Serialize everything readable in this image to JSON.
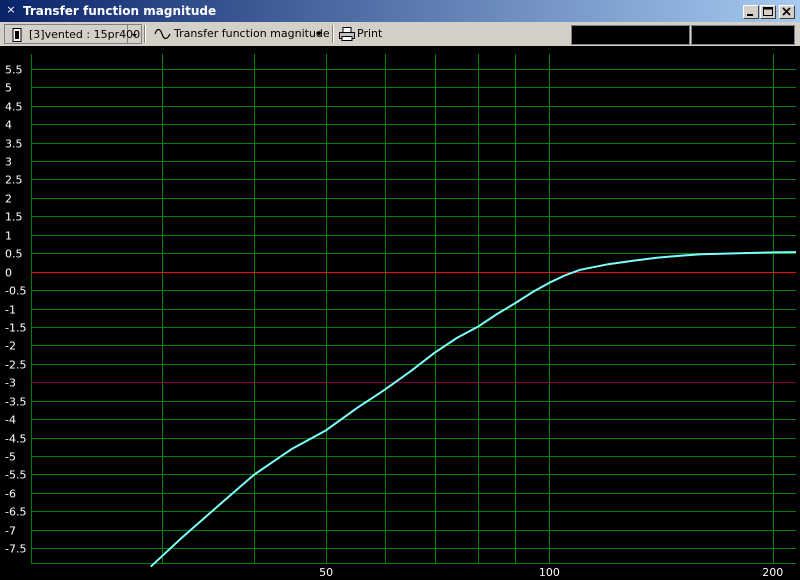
{
  "window": {
    "title": "Transfer function magnitude"
  },
  "toolbar": {
    "source_select_value": "[3]vented : 15pr400",
    "view_select_value": "Transfer function magnitude",
    "print_label": "Print",
    "readout_1": "",
    "readout_2": ""
  },
  "colors": {
    "plot_background": "#000000",
    "grid": "#008000",
    "zero_line": "#ff0000",
    "reference_line": "#800040",
    "curve": "#80ffff",
    "tick_labels": "#ffffff"
  },
  "chart_data": {
    "type": "line",
    "title": "",
    "xlabel": "",
    "ylabel": "",
    "x_scale": "log",
    "xlim": [
      20,
      215
    ],
    "ylim": [
      -7.9,
      5.9
    ],
    "x_ticks": [
      50,
      100,
      200
    ],
    "x_gridlines": [
      20,
      30,
      40,
      50,
      60,
      70,
      80,
      90,
      100,
      200
    ],
    "y_ticks": [
      5.5,
      5,
      4.5,
      4,
      3.5,
      3,
      2.5,
      2,
      1.5,
      1,
      0.5,
      0,
      -0.5,
      -1,
      -1.5,
      -2,
      -2.5,
      -3,
      -3.5,
      -4,
      -4.5,
      -5,
      -5.5,
      -6,
      -6.5,
      -7,
      -7.5
    ],
    "reference_lines": [
      {
        "y": 0,
        "color": "#ff0000"
      },
      {
        "y": -3,
        "color": "#800040"
      }
    ],
    "grid": true,
    "series": [
      {
        "color": "#80ffff",
        "x": [
          29,
          32,
          36,
          40,
          45,
          50,
          55,
          60,
          65,
          70,
          75,
          80,
          85,
          90,
          95,
          100,
          105,
          110,
          120,
          130,
          140,
          150,
          160,
          180,
          200,
          215
        ],
        "y": [
          -8.0,
          -7.2,
          -6.3,
          -5.5,
          -4.8,
          -4.3,
          -3.7,
          -3.2,
          -2.7,
          -2.2,
          -1.8,
          -1.5,
          -1.15,
          -0.85,
          -0.55,
          -0.3,
          -0.1,
          0.05,
          0.2,
          0.3,
          0.38,
          0.43,
          0.47,
          0.5,
          0.52,
          0.53
        ]
      }
    ]
  }
}
